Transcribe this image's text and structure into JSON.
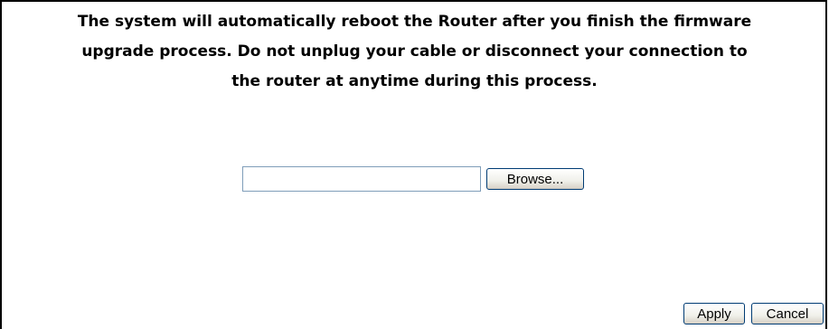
{
  "notice": {
    "lines": [
      "The system will automatically reboot the Router after you finish the firmware",
      "upgrade process. Do not unplug your cable or disconnect your connection to",
      "the router at anytime during this process."
    ]
  },
  "file_upload": {
    "value": "",
    "browse_label": "Browse..."
  },
  "actions": {
    "apply_label": "Apply",
    "cancel_label": "Cancel"
  },
  "colors": {
    "border": "#000000",
    "input_border": "#7f9db9",
    "button_border": "#003c74",
    "background": "#ffffff"
  }
}
